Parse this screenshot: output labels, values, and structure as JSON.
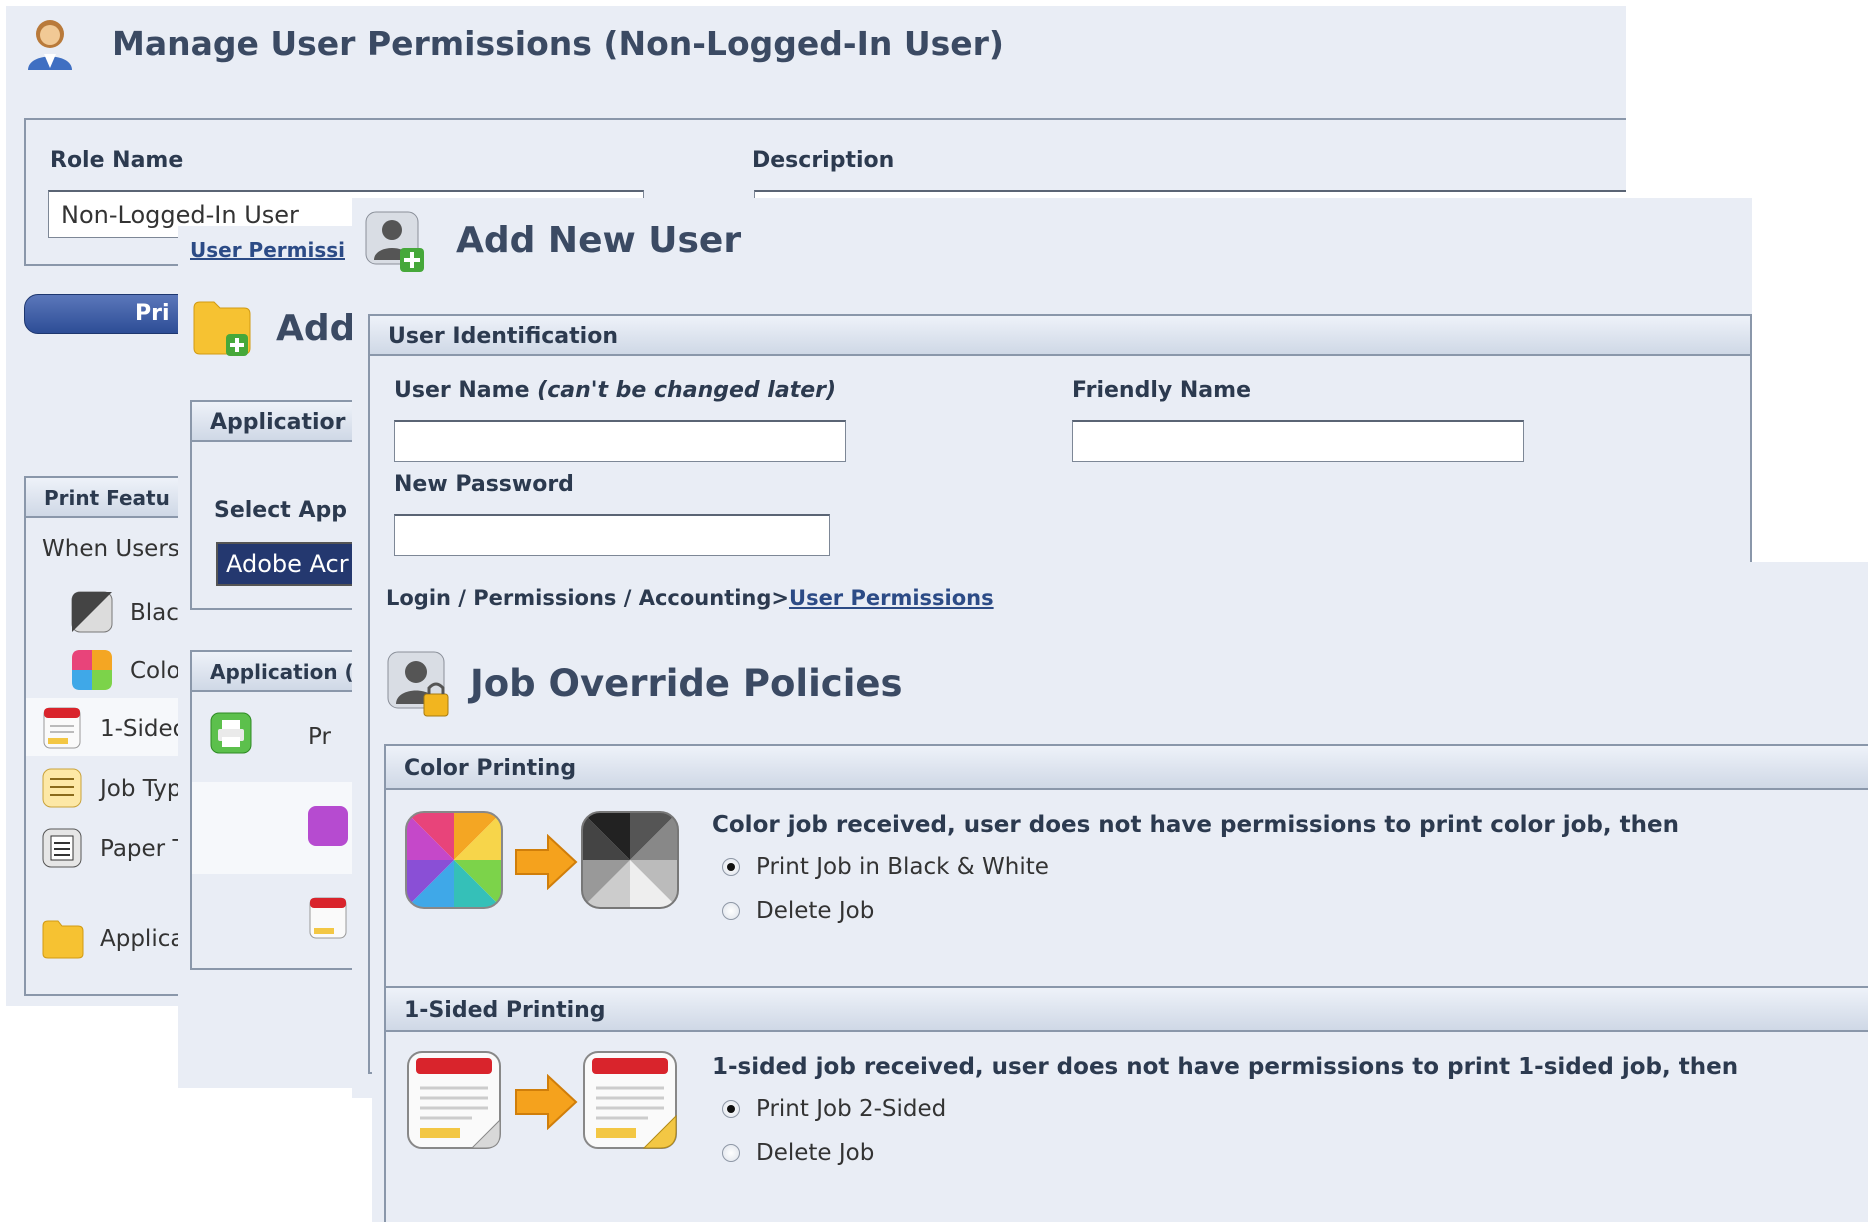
{
  "manage_window": {
    "title": "Manage User Permissions (Non-Logged-In User)",
    "role_name_label": "Role Name",
    "role_name_value": "Non-Logged-In User",
    "description_label": "Description",
    "print_button": "Pri",
    "print_features_header": "Print Featu",
    "when_users_text": "When Users",
    "feature_items": [
      "Blac",
      "Colo",
      "1-Sided",
      "Job Typ",
      "Paper T",
      "Applica"
    ]
  },
  "add_app_window": {
    "breadcrumb_link": "User Permissi",
    "title": "Add",
    "application_header": "Applicatior",
    "select_label": "Select App",
    "select_value": "Adobe Acr",
    "application_header2": "Application (",
    "row_text": "Pr"
  },
  "add_user_window": {
    "title": "Add New User",
    "section_header": "User Identification",
    "user_name_label": "User Name",
    "user_name_note": "(can't be changed later)",
    "friendly_name_label": "Friendly Name",
    "new_password_label": "New Password",
    "user_name_value": "",
    "friendly_name_value": "",
    "password_value": ""
  },
  "job_override_window": {
    "breadcrumb": {
      "prefix": "Login / Permissions / Accounting>",
      "link": "User Permissions"
    },
    "title": "Job Override Policies",
    "color_section": {
      "header": "Color Printing",
      "message": "Color job received, user does not have permissions to print color job, then",
      "options": [
        "Print Job in Black & White",
        "Delete Job"
      ],
      "selected": "Print Job in Black & White"
    },
    "sided_section": {
      "header": "1-Sided Printing",
      "message": "1-sided job received, user does not have permissions to print 1-sided job, then",
      "options": [
        "Print Job 2-Sided",
        "Delete Job"
      ],
      "selected": "Print Job 2-Sided"
    }
  },
  "colors": {
    "window_bg": "#e9edf5",
    "title_text": "#3b4a63",
    "link": "#2c4b86",
    "arrow": "#f5a21d"
  }
}
